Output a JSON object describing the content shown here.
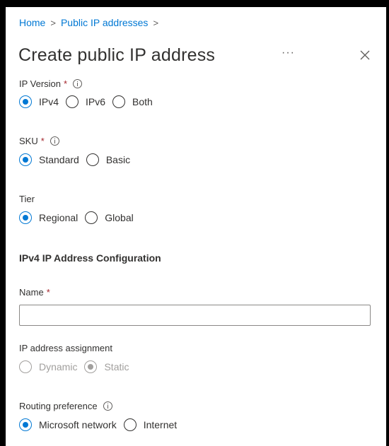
{
  "breadcrumb": {
    "home": "Home",
    "public_ip": "Public IP addresses",
    "sep1": ">",
    "sep2": ">"
  },
  "header": {
    "title": "Create public IP address",
    "more": "···"
  },
  "ip_version": {
    "label": "IP Version",
    "required": "*",
    "options": [
      "IPv4",
      "IPv6",
      "Both"
    ],
    "selected": "IPv4"
  },
  "sku": {
    "label": "SKU",
    "required": "*",
    "options": [
      "Standard",
      "Basic"
    ],
    "selected": "Standard"
  },
  "tier": {
    "label": "Tier",
    "options": [
      "Regional",
      "Global"
    ],
    "selected": "Regional"
  },
  "config_section": {
    "title": "IPv4 IP Address Configuration"
  },
  "name": {
    "label": "Name",
    "required": "*",
    "value": ""
  },
  "assignment": {
    "label": "IP address assignment",
    "options": [
      "Dynamic",
      "Static"
    ],
    "selected": "Static",
    "disabled": true
  },
  "routing": {
    "label": "Routing preference",
    "options": [
      "Microsoft network",
      "Internet"
    ],
    "selected": "Microsoft network"
  },
  "colors": {
    "accent": "#0078d4",
    "required": "#a4262c",
    "text": "#323130",
    "disabled": "#a19f9d"
  }
}
